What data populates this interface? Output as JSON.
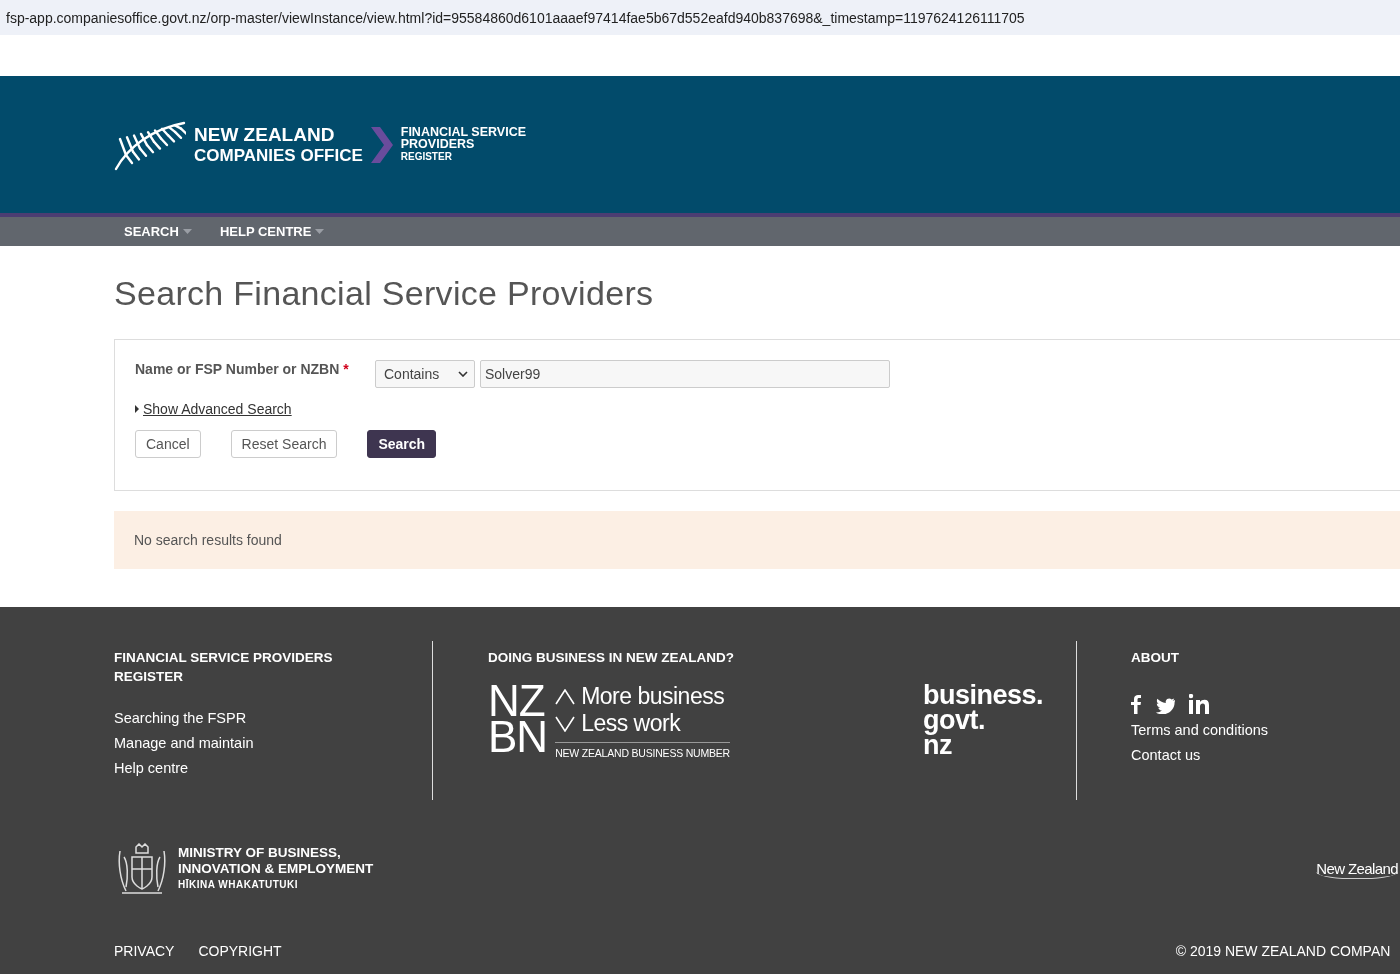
{
  "address_bar": {
    "url": "fsp-app.companiesoffice.govt.nz/orp-master/viewInstance/view.html?id=95584860d6101aaaef97414fae5b67d552eafd940b837698&_timestamp=1197624126111705"
  },
  "header": {
    "brand_lines": [
      "NEW ZEALAND",
      "COMPANIES OFFICE"
    ],
    "register_lines": [
      "FINANCIAL SERVICE",
      "PROVIDERS"
    ],
    "register_sub": "REGISTER"
  },
  "nav": [
    {
      "label": "SEARCH"
    },
    {
      "label": "HELP CENTRE"
    }
  ],
  "page_title": "Search Financial Service Providers",
  "search_form": {
    "field_label": "Name or FSP Number or NZBN",
    "required_mark": "*",
    "match_select": "Contains",
    "query": "Solver99",
    "advanced_link": "Show Advanced Search",
    "buttons": [
      {
        "label": "Cancel",
        "kind": "secondary"
      },
      {
        "label": "Reset Search",
        "kind": "secondary"
      },
      {
        "label": "Search",
        "kind": "primary"
      }
    ]
  },
  "notice": "No search results found",
  "footer": {
    "register": {
      "heading": "FINANCIAL SERVICE PROVIDERS REGISTER",
      "links": [
        "Searching the FSPR",
        "Manage and maintain",
        "Help centre"
      ]
    },
    "business": {
      "heading": "DOING BUSINESS IN NEW ZEALAND?",
      "nzbn_letters": [
        "NZ",
        "BN"
      ],
      "nzbn_more": "More business",
      "nzbn_less": "Less work",
      "nzbn_caption": "NEW ZEALAND BUSINESS NUMBER",
      "bgn_lines": [
        "business.",
        "govt.",
        "nz"
      ]
    },
    "about": {
      "heading": "ABOUT",
      "links": [
        "Terms and conditions",
        "Contact us"
      ]
    },
    "ministry_lines": [
      "MINISTRY OF BUSINESS,",
      "INNOVATION & EMPLOYMENT"
    ],
    "ministry_sub": "HĪKINA WHAKATUTUKI",
    "nz_wordmark": "New Zealand",
    "bottom_links": [
      "PRIVACY",
      "COPYRIGHT"
    ],
    "copyright": "© 2019 NEW ZEALAND COMPAN"
  }
}
